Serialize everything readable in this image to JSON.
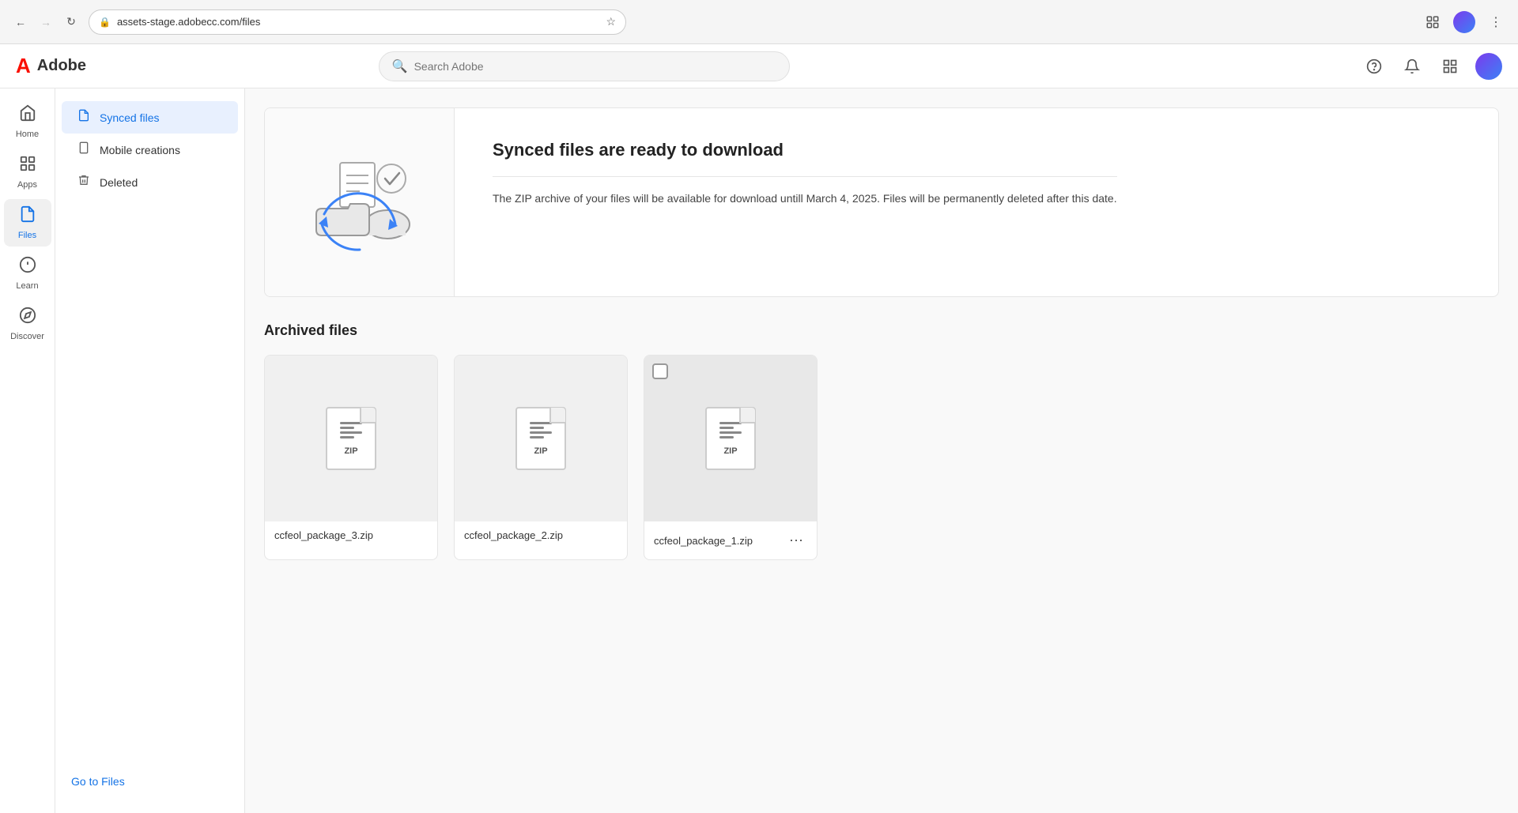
{
  "browser": {
    "url": "assets-stage.adobecc.com/files",
    "back_disabled": false,
    "forward_disabled": true
  },
  "app": {
    "logo": {
      "icon": "A",
      "text": "Adobe"
    },
    "search": {
      "placeholder": "Search Adobe"
    },
    "nav_icons": {
      "help": "?",
      "bell": "🔔",
      "grid": "⊞"
    }
  },
  "sidebar": {
    "items": [
      {
        "id": "home",
        "label": "Home",
        "icon": "⌂",
        "active": false
      },
      {
        "id": "apps",
        "label": "Apps",
        "icon": "⊞",
        "active": false
      },
      {
        "id": "files",
        "label": "Files",
        "icon": "📄",
        "active": true
      },
      {
        "id": "learn",
        "label": "Learn",
        "icon": "💡",
        "active": false
      },
      {
        "id": "discover",
        "label": "Discover",
        "icon": "🔍",
        "active": false
      }
    ]
  },
  "secondary_nav": {
    "items": [
      {
        "id": "synced-files",
        "label": "Synced files",
        "icon": "📄",
        "active": true
      },
      {
        "id": "mobile-creations",
        "label": "Mobile creations",
        "icon": "📱",
        "active": false
      },
      {
        "id": "deleted",
        "label": "Deleted",
        "icon": "🗑",
        "active": false
      }
    ],
    "goto_files": "Go to Files"
  },
  "banner": {
    "title": "Synced files are ready to download",
    "description": "The ZIP archive of your files will be available for download untill March 4, 2025. Files will be permanently deleted after this date."
  },
  "archived_section": {
    "title": "Archived files",
    "files": [
      {
        "id": "file-3",
        "name": "ccfeol_package_3.zip",
        "label": "ZIP",
        "selected": false,
        "show_more": false
      },
      {
        "id": "file-2",
        "name": "ccfeol_package_2.zip",
        "label": "ZIP",
        "selected": false,
        "show_more": false
      },
      {
        "id": "file-1",
        "name": "ccfeol_package_1.zip",
        "label": "ZIP",
        "selected": true,
        "show_more": true
      }
    ]
  },
  "colors": {
    "accent": "#1473e6",
    "adobe_red": "#fa0f00"
  }
}
